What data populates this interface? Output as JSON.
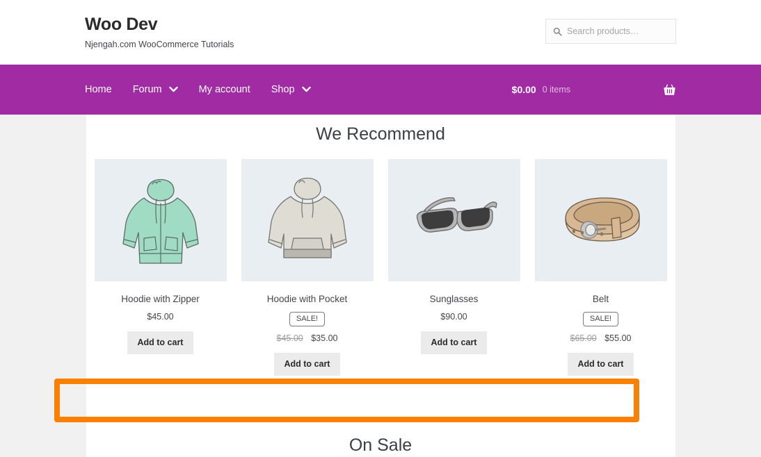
{
  "header": {
    "brand_title": "Woo Dev",
    "brand_tagline": "Njengah.com WooCommerce Tutorials",
    "search": {
      "placeholder": "Search products…",
      "value": "",
      "icon": "search-icon"
    }
  },
  "nav": {
    "background_color": "#a02ba3",
    "items": [
      {
        "label": "Home",
        "has_caret": false
      },
      {
        "label": "Forum",
        "has_caret": true,
        "caret": "▼"
      },
      {
        "label": "My account",
        "has_caret": false
      },
      {
        "label": "Shop",
        "has_caret": true,
        "caret": "▼"
      }
    ],
    "cart": {
      "amount": "$0.00",
      "count": "0 items",
      "icon": "shopping-basket-icon"
    }
  },
  "sections": [
    {
      "id": "we-recommend",
      "heading": "We Recommend"
    },
    {
      "id": "on-sale",
      "heading": "On Sale"
    }
  ],
  "products": [
    {
      "title": "Hoodie with Zipper",
      "image": "green-zip-hoodie",
      "on_sale": false,
      "sale_label": "",
      "price_old": "",
      "price": "$45.00",
      "add_to_cart_label": "Add to cart"
    },
    {
      "title": "Hoodie with Pocket",
      "image": "grey-pocket-hoodie",
      "on_sale": true,
      "sale_label": "SALE!",
      "price_old": "$45.00",
      "price": "$35.00",
      "add_to_cart_label": "Add to cart"
    },
    {
      "title": "Sunglasses",
      "image": "sunglasses",
      "on_sale": false,
      "sale_label": "",
      "price_old": "",
      "price": "$90.00",
      "add_to_cart_label": "Add to cart"
    },
    {
      "title": "Belt",
      "image": "leather-belt",
      "on_sale": true,
      "sale_label": "SALE!",
      "price_old": "$65.00",
      "price": "$55.00",
      "add_to_cart_label": "Add to cart"
    }
  ],
  "annotation": {
    "type": "highlight-rectangle",
    "color": "#fa8004"
  }
}
